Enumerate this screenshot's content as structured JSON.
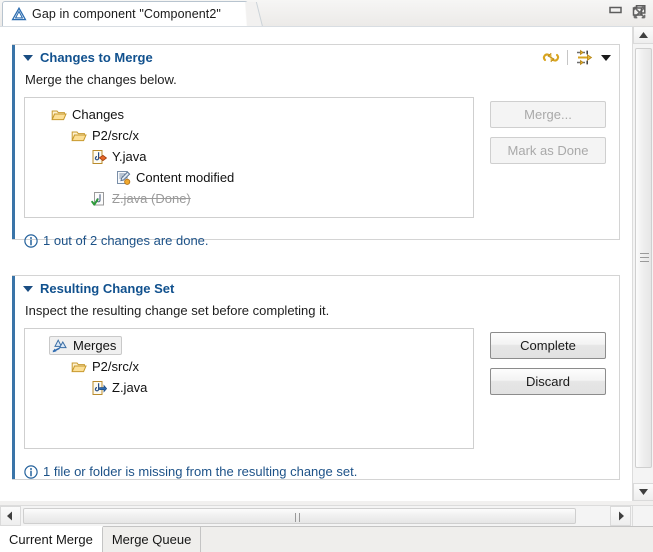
{
  "window": {
    "tab_title": "Gap in component \"Component2\"",
    "tab_icon": "warning-triangle-icon",
    "close_glyph": "✖",
    "minimize_label": "Minimize",
    "maximize_label": "Maximize"
  },
  "accent_color": "#11518e",
  "sections": [
    {
      "title": "Changes to Merge",
      "description": "Merge the changes below.",
      "tools": [
        {
          "name": "refresh-changes-icon",
          "label": "Refresh"
        },
        {
          "name": "collapse-all-icon",
          "label": "View Menu"
        }
      ],
      "tree": [
        {
          "label": "Changes",
          "icon": "folder-icon",
          "indent": 0,
          "state": "normal",
          "selected": false
        },
        {
          "label": "P2/src/x",
          "icon": "folder-icon",
          "indent": 1,
          "state": "normal",
          "selected": false
        },
        {
          "label": "Y.java",
          "icon": "java-file-changed-icon",
          "indent": 2,
          "state": "normal",
          "selected": false
        },
        {
          "label": "Content modified",
          "icon": "content-modified-icon",
          "indent": 3,
          "state": "normal",
          "selected": false
        },
        {
          "label": "Z.java (Done)",
          "icon": "java-file-done-icon",
          "indent": 2,
          "state": "done",
          "selected": false
        }
      ],
      "status": {
        "icon": "info-icon",
        "text": "1 out of 2 changes are done."
      },
      "buttons": [
        {
          "label": "Merge...",
          "enabled": false
        },
        {
          "label": "Mark as Done",
          "enabled": false
        }
      ]
    },
    {
      "title": "Resulting Change Set",
      "description": "Inspect the resulting change set before completing it.",
      "tools": [],
      "tree": [
        {
          "label": "Merges",
          "icon": "merges-icon",
          "indent": 0,
          "state": "normal",
          "selected": true
        },
        {
          "label": "P2/src/x",
          "icon": "folder-icon",
          "indent": 1,
          "state": "normal",
          "selected": false
        },
        {
          "label": "Z.java",
          "icon": "java-file-merged-icon",
          "indent": 2,
          "state": "normal",
          "selected": false
        }
      ],
      "status": {
        "icon": "info-icon",
        "text": "1 file or folder is missing from the resulting change set."
      },
      "buttons": [
        {
          "label": "Complete",
          "enabled": true
        },
        {
          "label": "Discard",
          "enabled": true
        }
      ]
    }
  ],
  "bottom_tabs": [
    {
      "label": "Current Merge",
      "active": true
    },
    {
      "label": "Merge Queue",
      "active": false
    }
  ],
  "scrollbars": {
    "vertical_label": "Vertical scrollbar",
    "horizontal_label": "Horizontal scrollbar"
  }
}
